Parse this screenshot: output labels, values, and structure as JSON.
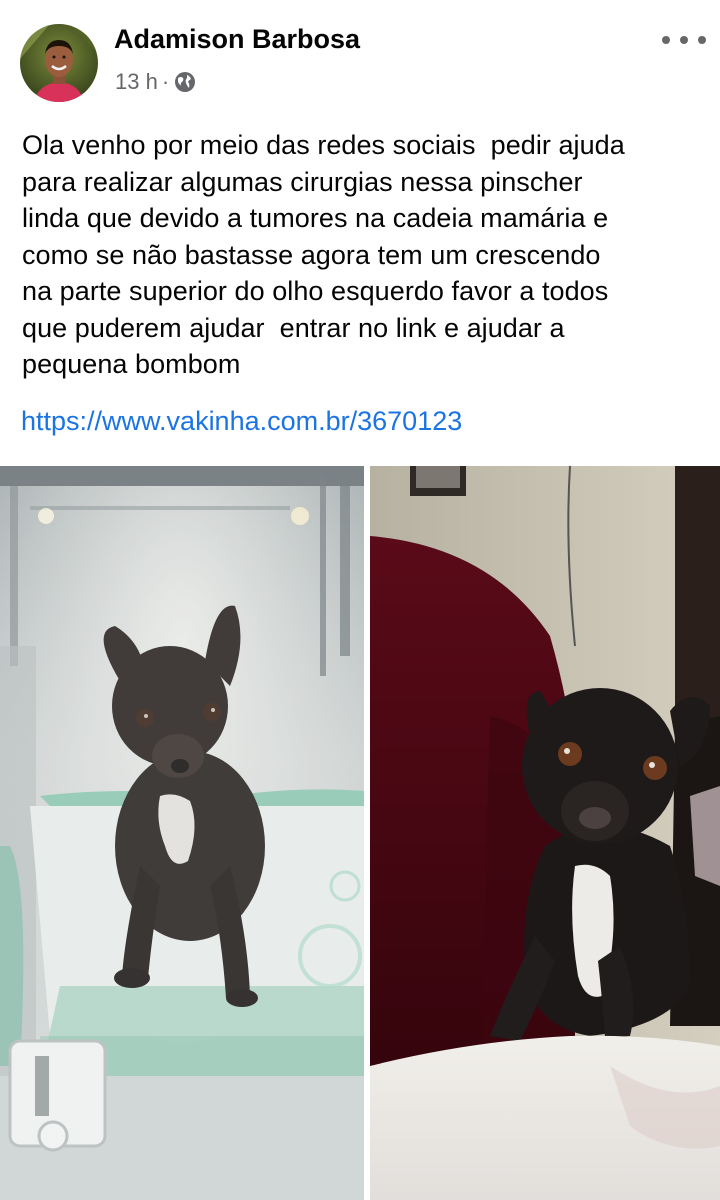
{
  "post": {
    "author_name": "Adamison Barbosa",
    "timestamp": "13 h",
    "separator": "·",
    "audience_icon": "globe-icon",
    "more_icon": "more-options-icon",
    "text": "Ola venho por meio das redes sociais  pedir ajuda\npara realizar algumas cirurgias nessa pinscher\nlinda que devido a tumores na cadeia mamária e\ncomo se não bastasse agora tem um crescendo\nna parte superior do olho esquerdo favor a todos\nque puderem ajudar  entrar no link e ajudar a\npequena bombom",
    "link": "https://www.vakinha.com.br/3670123"
  },
  "photos": [
    {
      "name": "dog-in-clinic-enclosure"
    },
    {
      "name": "dog-on-sofa"
    }
  ],
  "colors": {
    "text": "#050505",
    "secondary": "#65676b",
    "link": "#1b74e4",
    "background": "#ffffff"
  }
}
